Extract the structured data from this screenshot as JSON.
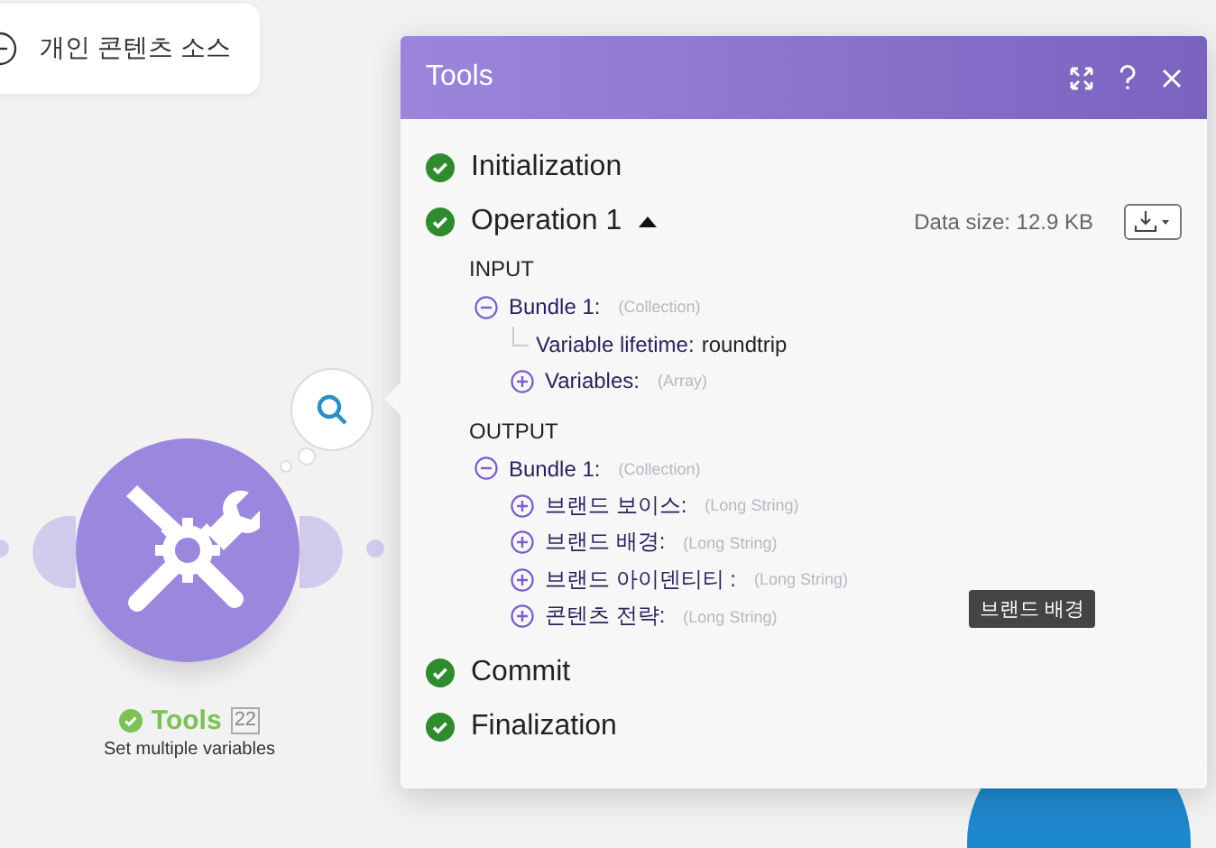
{
  "source_card": {
    "label": "개인 콘텐츠 소스"
  },
  "module": {
    "name": "Tools",
    "completed": true,
    "count": "22",
    "subtitle": "Set multiple variables"
  },
  "panel": {
    "title": "Tools",
    "steps": [
      {
        "label": "Initialization",
        "completed": true
      },
      {
        "label": "Operation 1",
        "completed": true,
        "expanded": true,
        "data_size": "Data size: 12.9 KB",
        "sections": [
          {
            "heading": "INPUT",
            "items": [
              {
                "kind": "node",
                "label": "Bundle 1:",
                "type": "(Collection)",
                "expanded": true,
                "children": [
                  {
                    "kind": "value",
                    "label": "Variable lifetime:",
                    "value": "roundtrip"
                  },
                  {
                    "kind": "node",
                    "label": "Variables:",
                    "type": "(Array)",
                    "expanded": false
                  }
                ]
              }
            ]
          },
          {
            "heading": "OUTPUT",
            "items": [
              {
                "kind": "node",
                "label": "Bundle 1:",
                "type": "(Collection)",
                "expanded": true,
                "children": [
                  {
                    "kind": "node",
                    "label": "브랜드 보이스:",
                    "type": "(Long String)",
                    "expanded": false
                  },
                  {
                    "kind": "node",
                    "label": "브랜드 배경:",
                    "type": "(Long String)",
                    "expanded": false
                  },
                  {
                    "kind": "node",
                    "label": "브랜드 아이덴티티 :",
                    "type": "(Long String)",
                    "expanded": false
                  },
                  {
                    "kind": "node",
                    "label": "콘텐츠 전략:",
                    "type": "(Long String)",
                    "expanded": false
                  }
                ]
              }
            ]
          }
        ]
      },
      {
        "label": "Commit",
        "completed": true
      },
      {
        "label": "Finalization",
        "completed": true
      }
    ]
  },
  "tooltip": "브랜드 배경"
}
